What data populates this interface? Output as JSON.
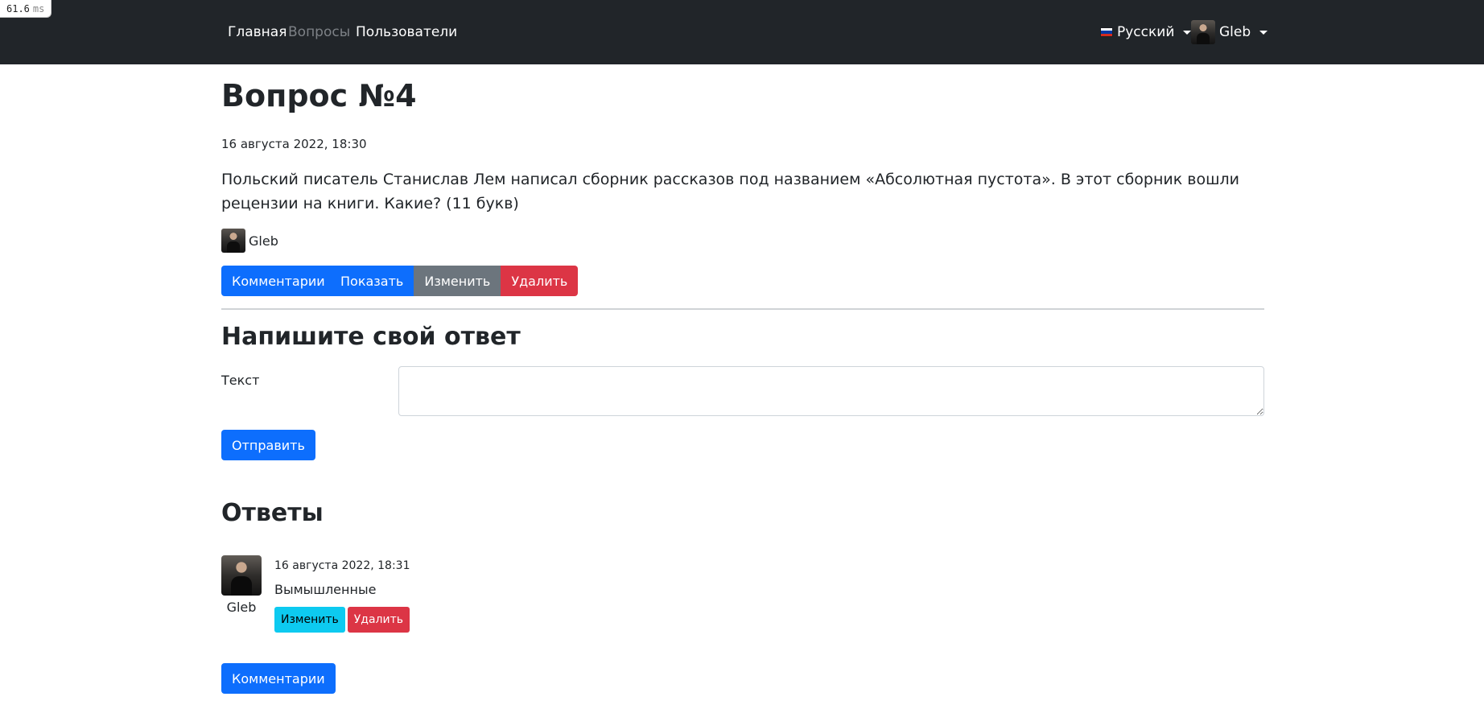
{
  "timing": {
    "value": "61.6",
    "unit": "ms"
  },
  "navbar": {
    "links": [
      {
        "label": "Главная"
      },
      {
        "label": "Вопросы"
      },
      {
        "label": "Пользователи"
      }
    ],
    "language": {
      "label": "Русский",
      "flag_colors": [
        "#ffffff",
        "#0039a6",
        "#d52b1e"
      ]
    },
    "user": {
      "name": "Gleb"
    }
  },
  "question": {
    "title": "Вопрос №4",
    "date": "16 августа 2022, 18:30",
    "text": "Польский писатель Станислав Лем написал сборник рассказов под названием «Абсолютная пустота». В этот сборник вошли рецензии на книги. Какие? (11 букв)",
    "author": "Gleb",
    "buttons": {
      "comments": "Комментарии",
      "show": "Показать",
      "edit": "Изменить",
      "delete": "Удалить"
    }
  },
  "answer_form": {
    "heading": "Напишите свой ответ",
    "text_label": "Текст",
    "text_value": "",
    "submit": "Отправить"
  },
  "answers": {
    "heading": "Ответы",
    "items": [
      {
        "author": "Gleb",
        "date": "16 августа 2022, 18:31",
        "text": "Вымышленные",
        "edit": "Изменить",
        "delete": "Удалить"
      }
    ],
    "comments_button": "Комментарии"
  },
  "colors": {
    "navbar_bg": "#212529",
    "primary": "#0d6efd",
    "secondary": "#6c757d",
    "danger": "#dc3545",
    "info": "#0dcaf0"
  }
}
